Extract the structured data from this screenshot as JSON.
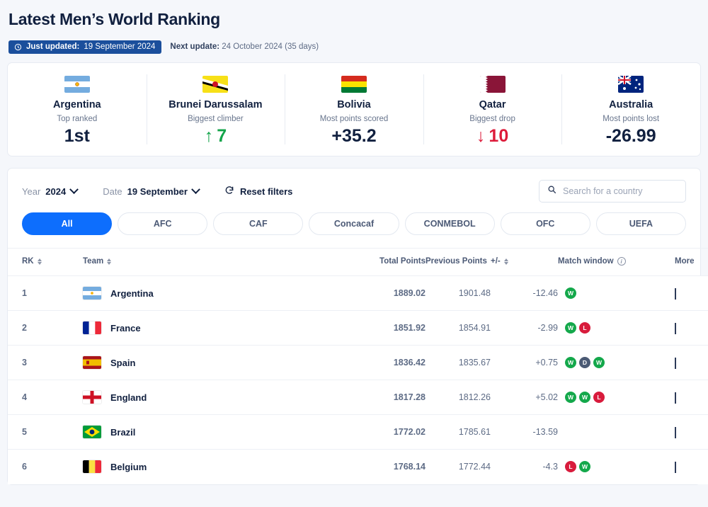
{
  "header": {
    "title": "Latest Men’s World Ranking",
    "updated_label": "Just updated:",
    "updated_date": "19 September 2024",
    "next_label": "Next update:",
    "next_value": "24 October 2024 (35 days)"
  },
  "stats": [
    {
      "country": "Argentina",
      "caption": "Top ranked",
      "value": "1st",
      "trend": "none",
      "arrow": ""
    },
    {
      "country": "Brunei Darussalam",
      "caption": "Biggest climber",
      "value": "7",
      "trend": "up",
      "arrow": "↑"
    },
    {
      "country": "Bolivia",
      "caption": "Most points scored",
      "value": "+35.2",
      "trend": "none",
      "arrow": ""
    },
    {
      "country": "Qatar",
      "caption": "Biggest drop",
      "value": "10",
      "trend": "down",
      "arrow": "↓"
    },
    {
      "country": "Australia",
      "caption": "Most points lost",
      "value": "-26.99",
      "trend": "none",
      "arrow": ""
    }
  ],
  "filters": {
    "year_label": "Year",
    "year_value": "2024",
    "date_label": "Date",
    "date_value": "19 September",
    "reset_label": "Reset filters"
  },
  "search": {
    "placeholder": "Search for a country",
    "value": ""
  },
  "confederations": [
    {
      "label": "All",
      "active": true
    },
    {
      "label": "AFC",
      "active": false
    },
    {
      "label": "CAF",
      "active": false
    },
    {
      "label": "Concacaf",
      "active": false
    },
    {
      "label": "CONMEBOL",
      "active": false
    },
    {
      "label": "OFC",
      "active": false
    },
    {
      "label": "UEFA",
      "active": false
    }
  ],
  "table": {
    "columns": {
      "rank": "RK",
      "team": "Team",
      "total_points": "Total Points",
      "previous_points": "Previous Points",
      "diff": "+/-",
      "match_window": "Match window",
      "more": "More"
    },
    "rows": [
      {
        "rank": "1",
        "team": "Argentina",
        "total": "1889.02",
        "previous": "1901.48",
        "diff": "-12.46",
        "results": [
          "W"
        ]
      },
      {
        "rank": "2",
        "team": "France",
        "total": "1851.92",
        "previous": "1854.91",
        "diff": "-2.99",
        "results": [
          "W",
          "L"
        ]
      },
      {
        "rank": "3",
        "team": "Spain",
        "total": "1836.42",
        "previous": "1835.67",
        "diff": "+0.75",
        "results": [
          "W",
          "D",
          "W"
        ]
      },
      {
        "rank": "4",
        "team": "England",
        "total": "1817.28",
        "previous": "1812.26",
        "diff": "+5.02",
        "results": [
          "W",
          "W",
          "L"
        ]
      },
      {
        "rank": "5",
        "team": "Brazil",
        "total": "1772.02",
        "previous": "1785.61",
        "diff": "-13.59",
        "results": []
      },
      {
        "rank": "6",
        "team": "Belgium",
        "total": "1768.14",
        "previous": "1772.44",
        "diff": "-4.3",
        "results": [
          "L",
          "W"
        ]
      }
    ]
  },
  "colors": {
    "accent_blue": "#0d6efd",
    "badge_navy": "#1b4f9c",
    "win_green": "#14a84b",
    "loss_red": "#d81b3c",
    "draw_slate": "#4b5a74",
    "text_dark": "#11203f"
  }
}
